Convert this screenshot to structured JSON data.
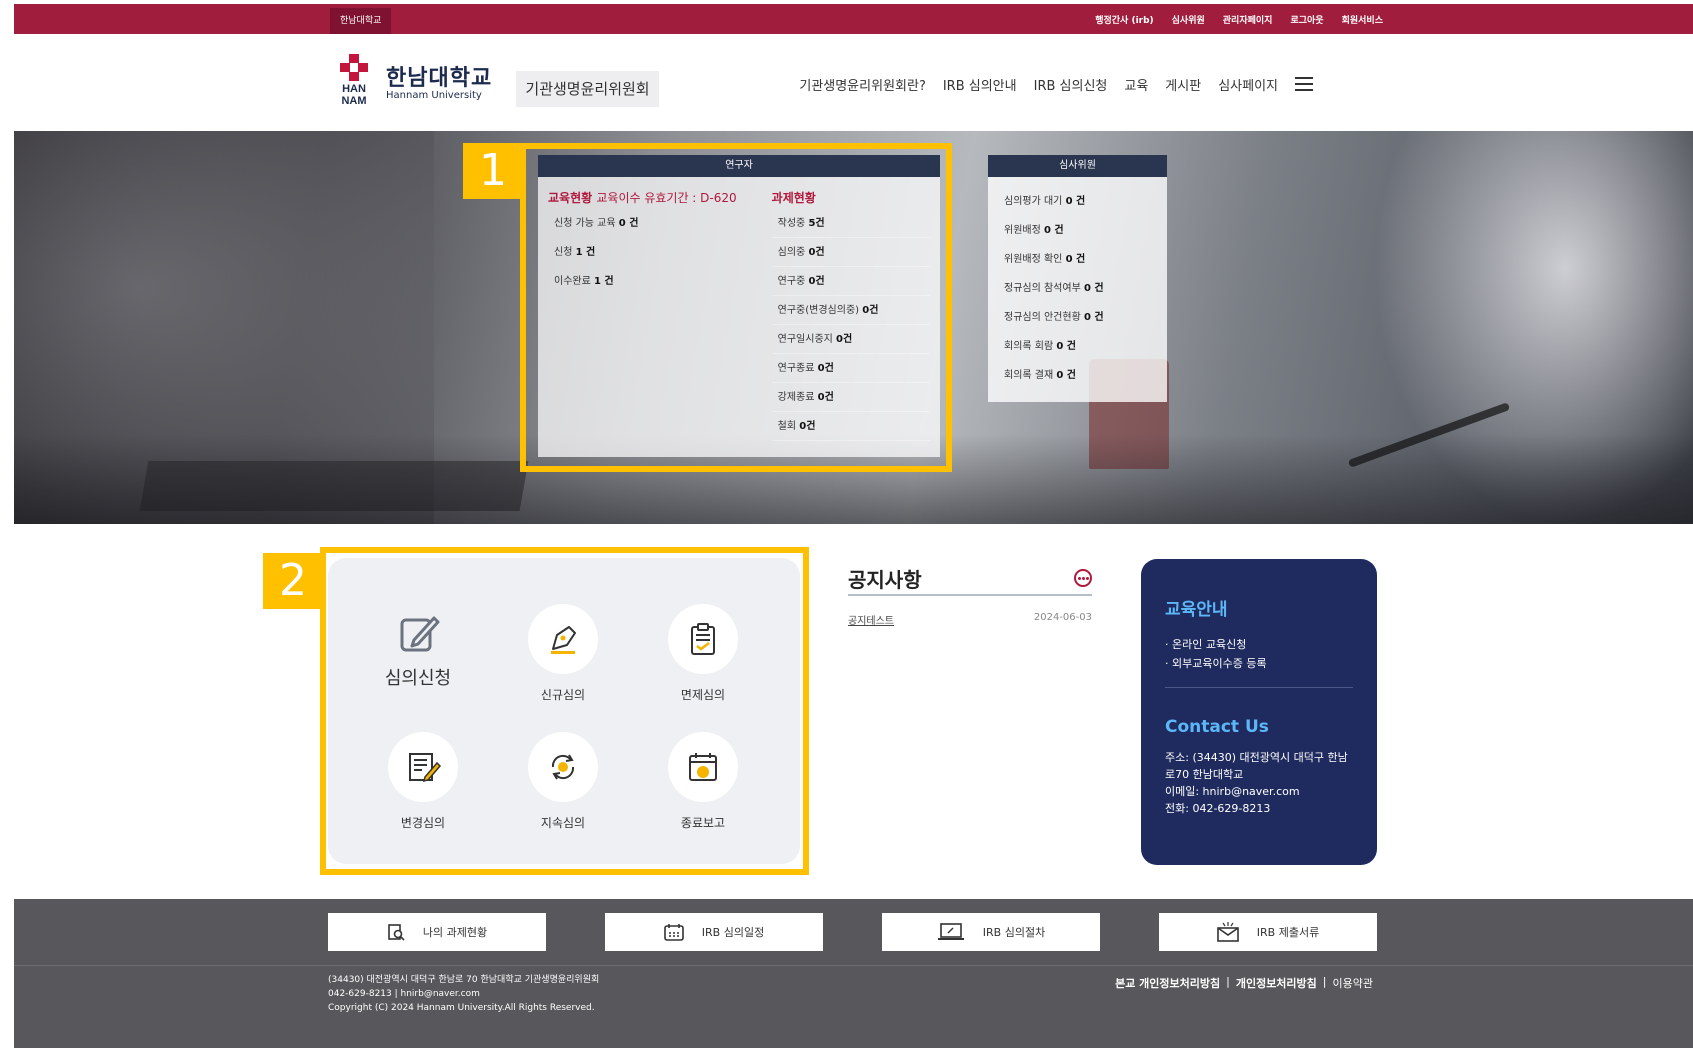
{
  "topbar": {
    "home_link": "한남대학교",
    "util": [
      "행정간사 (irb)",
      "심사위원",
      "관리자페이지",
      "로그아웃",
      "회원서비스"
    ]
  },
  "header": {
    "logo_mark_text_1": "HAN",
    "logo_mark_text_2": "NAM",
    "logo_name": "한남대학교",
    "logo_name_en": "Hannam University",
    "org_tag": "기관생명윤리위원회",
    "nav": [
      "기관생명윤리위원회란?",
      "IRB 심의안내",
      "IRB 심의신청",
      "교육",
      "게시판",
      "심사페이지"
    ]
  },
  "researcher_panel": {
    "title": "연구자",
    "edu_title": "교육현황",
    "edu_valid": "교육이수 유효기간 : D-620",
    "task_title": "과제현황",
    "edu_rows": [
      {
        "label": "신청 가능 교육 ",
        "value": "0 건"
      },
      {
        "label": "신청 ",
        "value": "1 건"
      },
      {
        "label": "이수완료 ",
        "value": "1 건"
      }
    ],
    "task_rows": [
      {
        "label": "작성중 ",
        "value": "5건"
      },
      {
        "label": "심의중 ",
        "value": "0건"
      },
      {
        "label": "연구중 ",
        "value": "0건"
      },
      {
        "label": "연구중(변경심의중) ",
        "value": "0건"
      },
      {
        "label": "연구일시중지 ",
        "value": "0건"
      },
      {
        "label": "연구종료 ",
        "value": "0건"
      },
      {
        "label": "강제종료 ",
        "value": "0건"
      },
      {
        "label": "철회 ",
        "value": "0건"
      }
    ]
  },
  "reviewer_panel": {
    "title": "심사위원",
    "rows": [
      {
        "label": "심의평가 대기 ",
        "value": "0 건"
      },
      {
        "label": "위원배정 ",
        "value": "0 건"
      },
      {
        "label": "위원배정 확인 ",
        "value": "0 건"
      },
      {
        "label": "정규심의 참석여부 ",
        "value": "0 건"
      },
      {
        "label": "정규심의 안건현황 ",
        "value": "0 건"
      },
      {
        "label": "회의록 회람 ",
        "value": "0 건"
      },
      {
        "label": "회의록 결재 ",
        "value": "0 건"
      }
    ]
  },
  "annotations": {
    "badge1": "1",
    "badge2": "2"
  },
  "services": {
    "main_label": "심의신청",
    "items": [
      "신규심의",
      "면제심의",
      "변경심의",
      "지속심의",
      "종료보고"
    ]
  },
  "notice": {
    "title": "공지사항",
    "items": [
      {
        "title": "공지테스트",
        "date": "2024-06-03"
      }
    ]
  },
  "info_card": {
    "edu_title": "교육안내",
    "edu_links": [
      "· 온라인 교육신청",
      "· 외부교육이수증 등록"
    ],
    "contact_title": "Contact Us",
    "address": "주소: (34430) 대전광역시 대덕구 한남로70 한남대학교",
    "email": "이메일: hnirb@naver.com",
    "phone": "전화: 042-629-8213"
  },
  "footer": {
    "quick_links": [
      "나의 과제현황",
      "IRB 심의일정",
      "IRB 심의절차",
      "IRB 제출서류"
    ],
    "address_line": "(34430) 대전광역시 대덕구 한남로 70 한남대학교 기관생명윤리위원회",
    "contact_line": "042-629-8213 | hnirb@naver.com",
    "copyright": "Copyright (C) 2024 Hannam University.All Rights Reserved.",
    "policy_1": "본교 개인정보처리방침",
    "policy_2": "개인정보처리방침",
    "policy_3": "이용약관",
    "policy_sep": "|"
  },
  "colors": {
    "brand_red": "#a11d3e",
    "accent_yellow": "#ffc000",
    "navy": "#1f2b5e",
    "sky": "#5bb7f7"
  }
}
